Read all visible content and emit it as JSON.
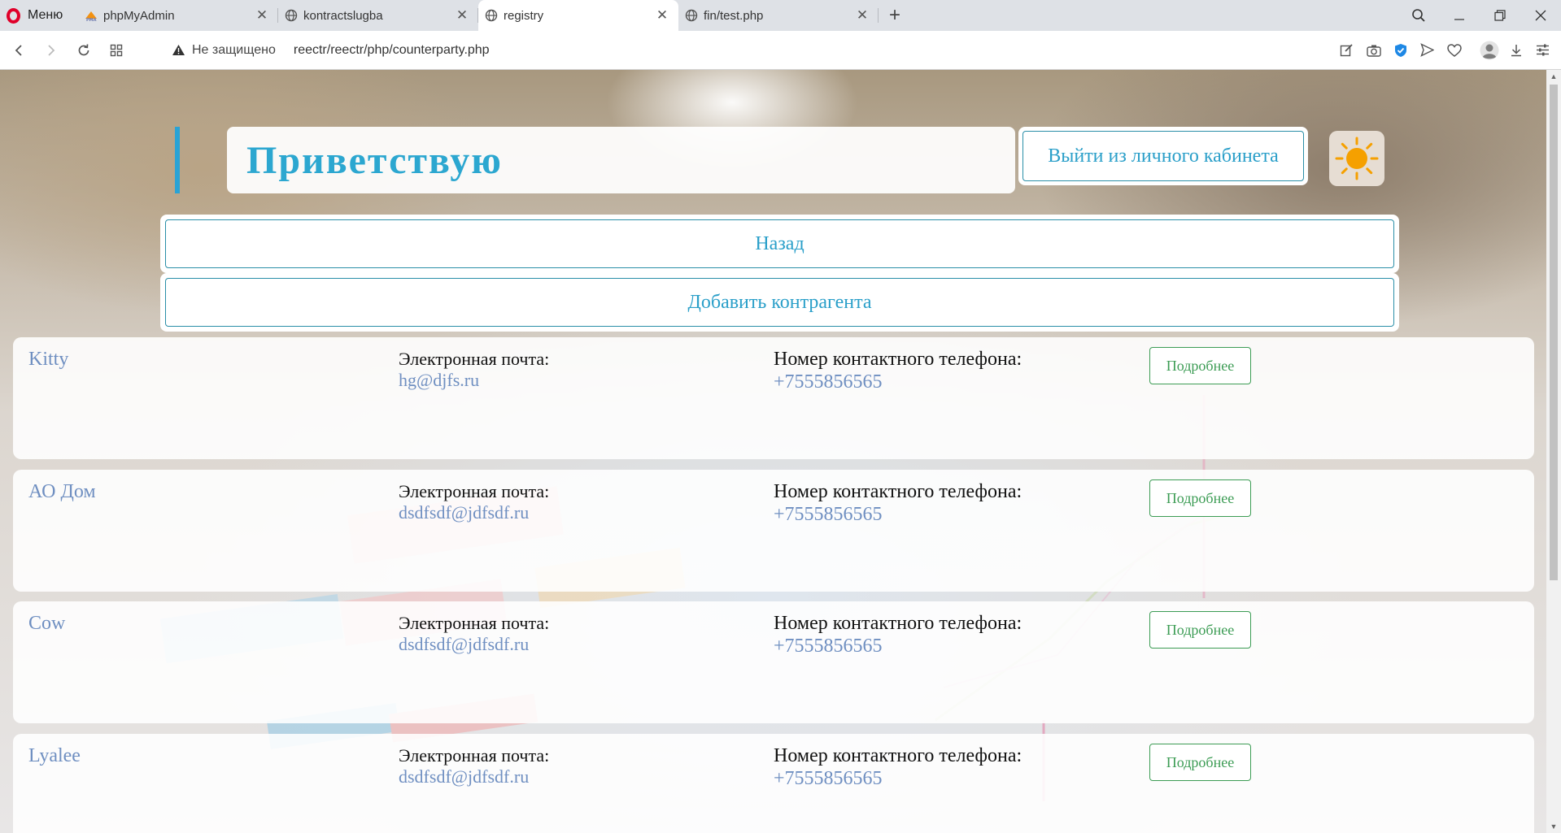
{
  "browser": {
    "menu_label": "Меню",
    "tabs": [
      {
        "title": "phpMyAdmin"
      },
      {
        "title": "kontractslugba"
      },
      {
        "title": "registry"
      },
      {
        "title": "fin/test.php"
      }
    ],
    "security_text": "Не защищено",
    "url": "reectr/reectr/php/counterparty.php"
  },
  "header": {
    "greeting": "Приветствую",
    "logout_label": "Выйти из личного кабинета"
  },
  "actions": {
    "back_label": "Назад",
    "add_label": "Добавить контрагента"
  },
  "counterparties": [
    {
      "name": "Kitty",
      "email_label": "Электронная почта:",
      "email": "hg@djfs.ru",
      "phone_label": "Номер контактного телефона:",
      "phone": "+7555856565",
      "details_label": "Подробнее"
    },
    {
      "name": "АО Дом",
      "email_label": "Электронная почта:",
      "email": "dsdfsdf@jdfsdf.ru",
      "phone_label": "Номер контактного телефона:",
      "phone": "+7555856565",
      "details_label": "Подробнее"
    },
    {
      "name": "Cow",
      "email_label": "Электронная почта:",
      "email": "dsdfsdf@jdfsdf.ru",
      "phone_label": "Номер контактного телефона:",
      "phone": "+7555856565",
      "details_label": "Подробнее"
    },
    {
      "name": "Lyalee",
      "email_label": "Электронная почта:",
      "email": "dsdfsdf@jdfsdf.ru",
      "phone_label": "Номер контактного телефона:",
      "phone": "+7555856565",
      "details_label": "Подробнее"
    }
  ],
  "colors": {
    "accent": "#2ca7d0",
    "details_green": "#3c9c54",
    "link_blue": "#6f8fc1",
    "sun": "#f5a000"
  }
}
